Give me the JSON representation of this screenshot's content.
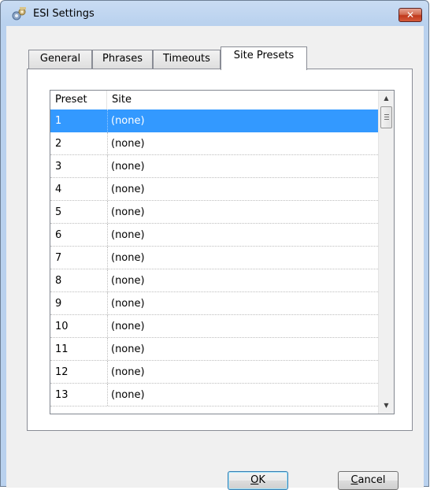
{
  "window": {
    "title": "ESI Settings",
    "close_glyph": "✕"
  },
  "icons": {
    "app": "settings-gears-icon",
    "close": "close-icon",
    "scroll_up": "up-arrow-icon",
    "scroll_down": "down-arrow-icon"
  },
  "tabs": [
    {
      "label": "General",
      "active": false
    },
    {
      "label": "Phrases",
      "active": false
    },
    {
      "label": "Timeouts",
      "active": false
    },
    {
      "label": "Site Presets",
      "active": true
    }
  ],
  "list": {
    "columns": {
      "preset": "Preset",
      "site": "Site"
    },
    "rows": [
      {
        "preset": "1",
        "site": "(none)",
        "selected": true
      },
      {
        "preset": "2",
        "site": "(none)"
      },
      {
        "preset": "3",
        "site": "(none)"
      },
      {
        "preset": "4",
        "site": "(none)"
      },
      {
        "preset": "5",
        "site": "(none)"
      },
      {
        "preset": "6",
        "site": "(none)"
      },
      {
        "preset": "7",
        "site": "(none)"
      },
      {
        "preset": "8",
        "site": "(none)"
      },
      {
        "preset": "9",
        "site": "(none)"
      },
      {
        "preset": "10",
        "site": "(none)"
      },
      {
        "preset": "11",
        "site": "(none)"
      },
      {
        "preset": "12",
        "site": "(none)"
      },
      {
        "preset": "13",
        "site": "(none)"
      }
    ]
  },
  "buttons": {
    "ok": {
      "accel": "O",
      "rest": "K"
    },
    "cancel": {
      "accel": "C",
      "rest": "ancel"
    }
  },
  "colors": {
    "selection": "#3399ff",
    "close_button": "#c0381c",
    "frame": "#b9d1ee"
  }
}
